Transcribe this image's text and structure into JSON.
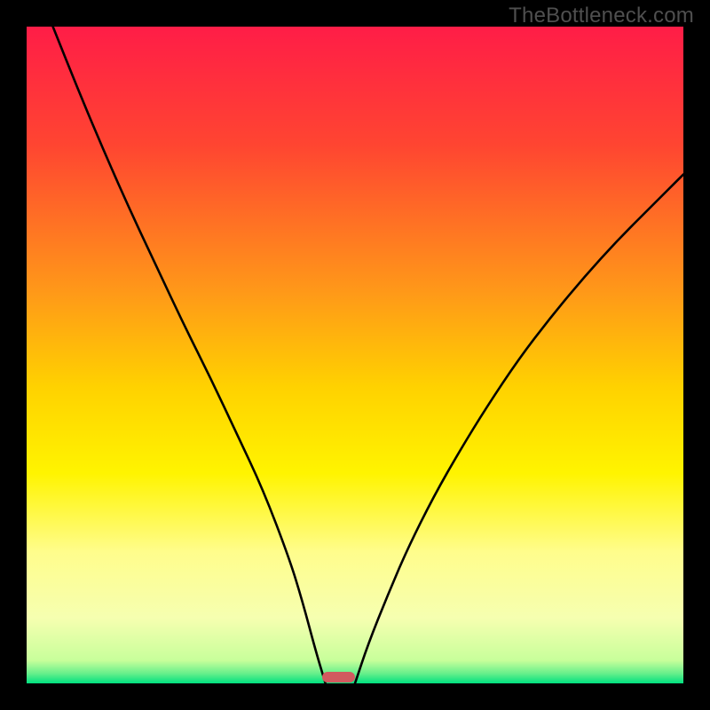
{
  "watermark": "TheBottleneck.com",
  "chart_data": {
    "type": "line",
    "title": "",
    "xlabel": "",
    "ylabel": "",
    "xlim": [
      0,
      100
    ],
    "ylim": [
      0,
      100
    ],
    "grid": false,
    "legend": false,
    "background_gradient": {
      "stops": [
        {
          "offset": 0,
          "color": "#ff1d47"
        },
        {
          "offset": 0.18,
          "color": "#ff4531"
        },
        {
          "offset": 0.4,
          "color": "#ff9719"
        },
        {
          "offset": 0.55,
          "color": "#ffd200"
        },
        {
          "offset": 0.68,
          "color": "#fff400"
        },
        {
          "offset": 0.8,
          "color": "#fffd8c"
        },
        {
          "offset": 0.9,
          "color": "#f6ffb0"
        },
        {
          "offset": 0.965,
          "color": "#c8ff9b"
        },
        {
          "offset": 0.985,
          "color": "#66ef8b"
        },
        {
          "offset": 1.0,
          "color": "#00e080"
        }
      ]
    },
    "series": [
      {
        "name": "left-curve",
        "x": [
          4,
          8,
          12,
          16,
          20,
          24,
          28,
          32,
          36,
          40,
          42,
          44,
          45.5
        ],
        "y": [
          100,
          90,
          80.5,
          71.5,
          63,
          54.5,
          46.5,
          38,
          29.5,
          19,
          12.5,
          5,
          0
        ]
      },
      {
        "name": "right-curve",
        "x": [
          50,
          52,
          55,
          58,
          62,
          66,
          70,
          75,
          80,
          85,
          90,
          95,
          100
        ],
        "y": [
          0,
          6,
          13.5,
          20.5,
          28.5,
          35.5,
          42,
          49.5,
          56,
          62,
          67.5,
          72.5,
          77.5
        ]
      }
    ],
    "marker": {
      "name": "bottleneck-marker",
      "x_center": 47.5,
      "width": 5,
      "color": "#d15a5f"
    }
  }
}
